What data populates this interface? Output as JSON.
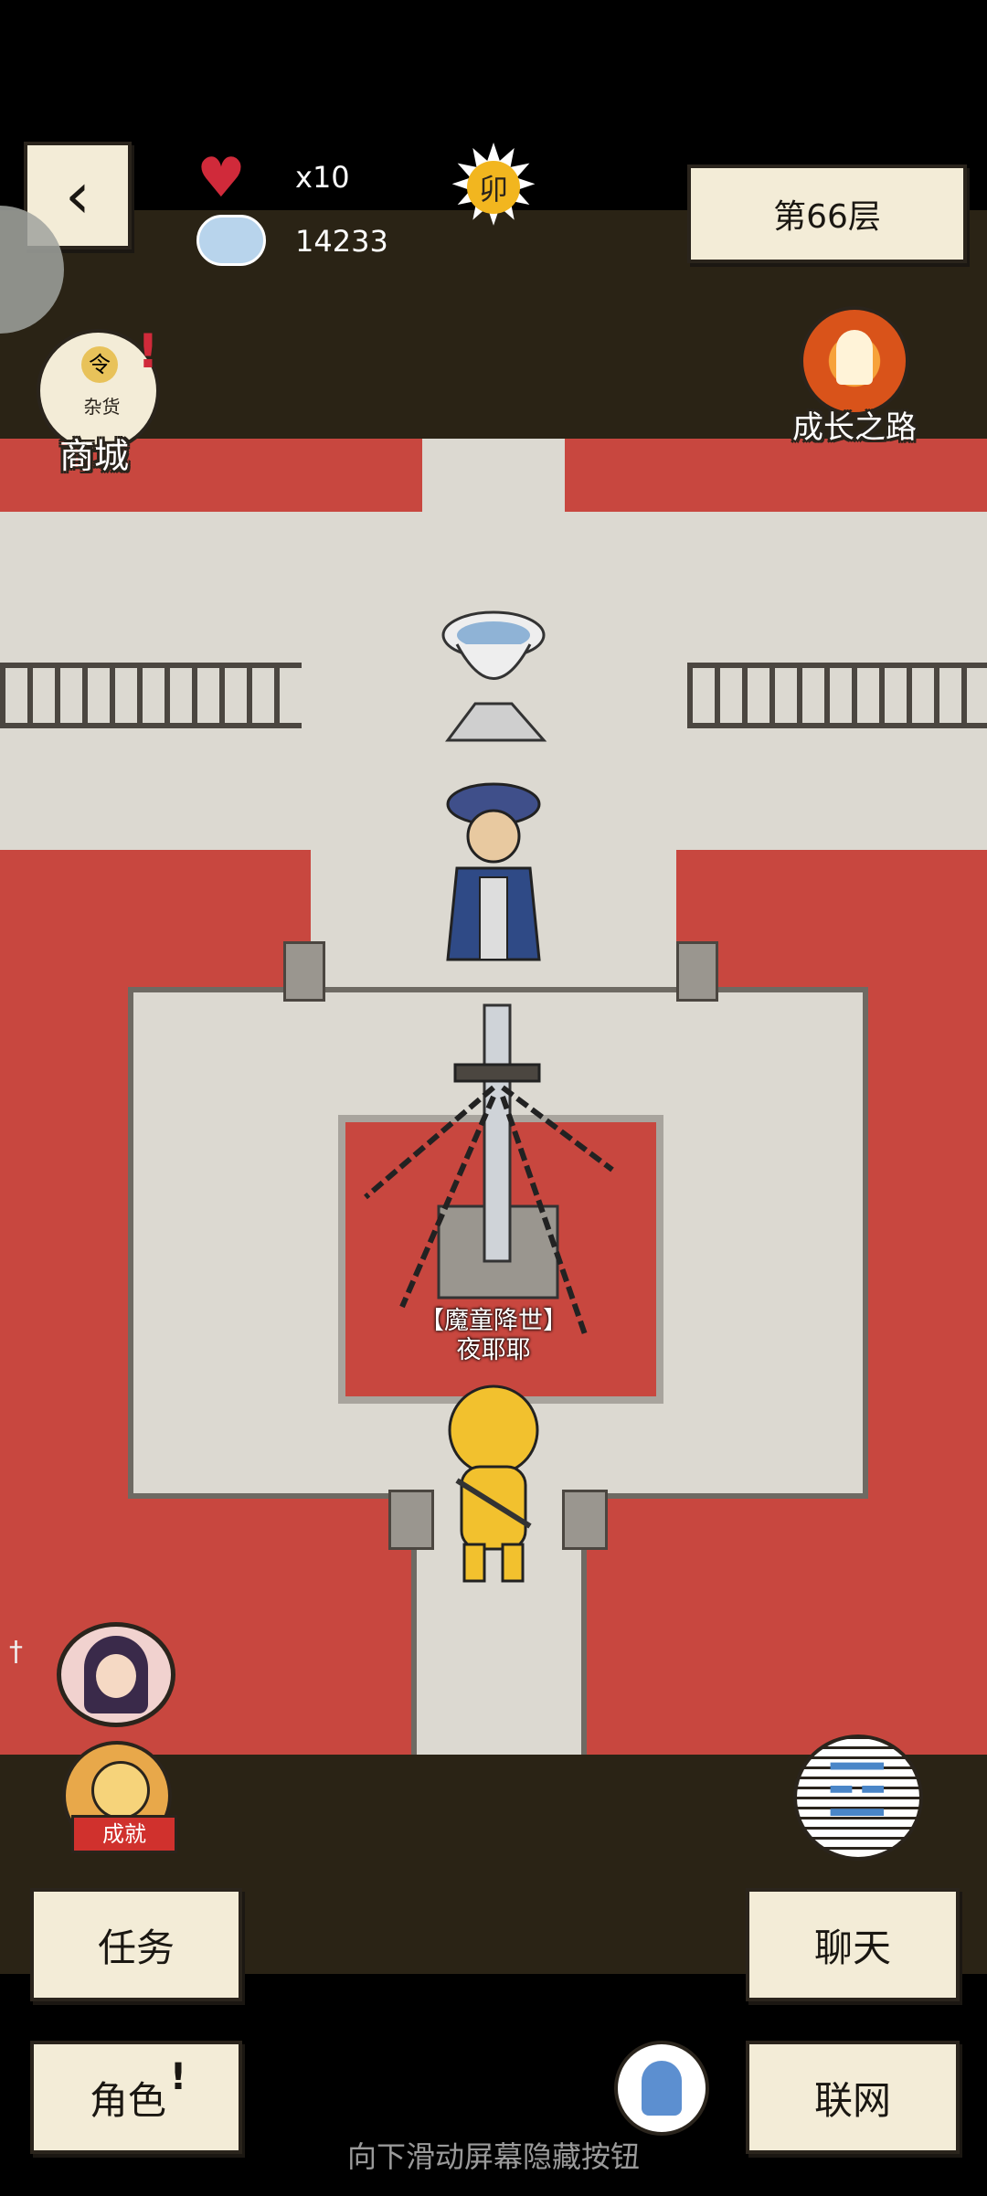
{
  "hud": {
    "hearts_count": "x10",
    "currency_amount": "14233",
    "sun_badge_char": "卯",
    "floor_label": "第66层"
  },
  "top_left": {
    "shop_label": "商城",
    "shop_sign_top": "令",
    "shop_sign_bottom": "杂货"
  },
  "top_right": {
    "growth_label": "成长之路"
  },
  "scene": {
    "npc_title": "【魔童降世】",
    "npc_name": "夜耶耶"
  },
  "side": {
    "achievement_label": "成就"
  },
  "bottom_buttons": {
    "task": "任务",
    "chat": "聊天",
    "role": "角色",
    "role_alert": "!",
    "online": "联网"
  },
  "hint": "向下滑动屏幕隐藏按钮",
  "colors": {
    "water_red": "#c8473f",
    "stone": "#dcd9d1",
    "hud_band": "#2a2315",
    "paper": "#f3ecd7"
  }
}
